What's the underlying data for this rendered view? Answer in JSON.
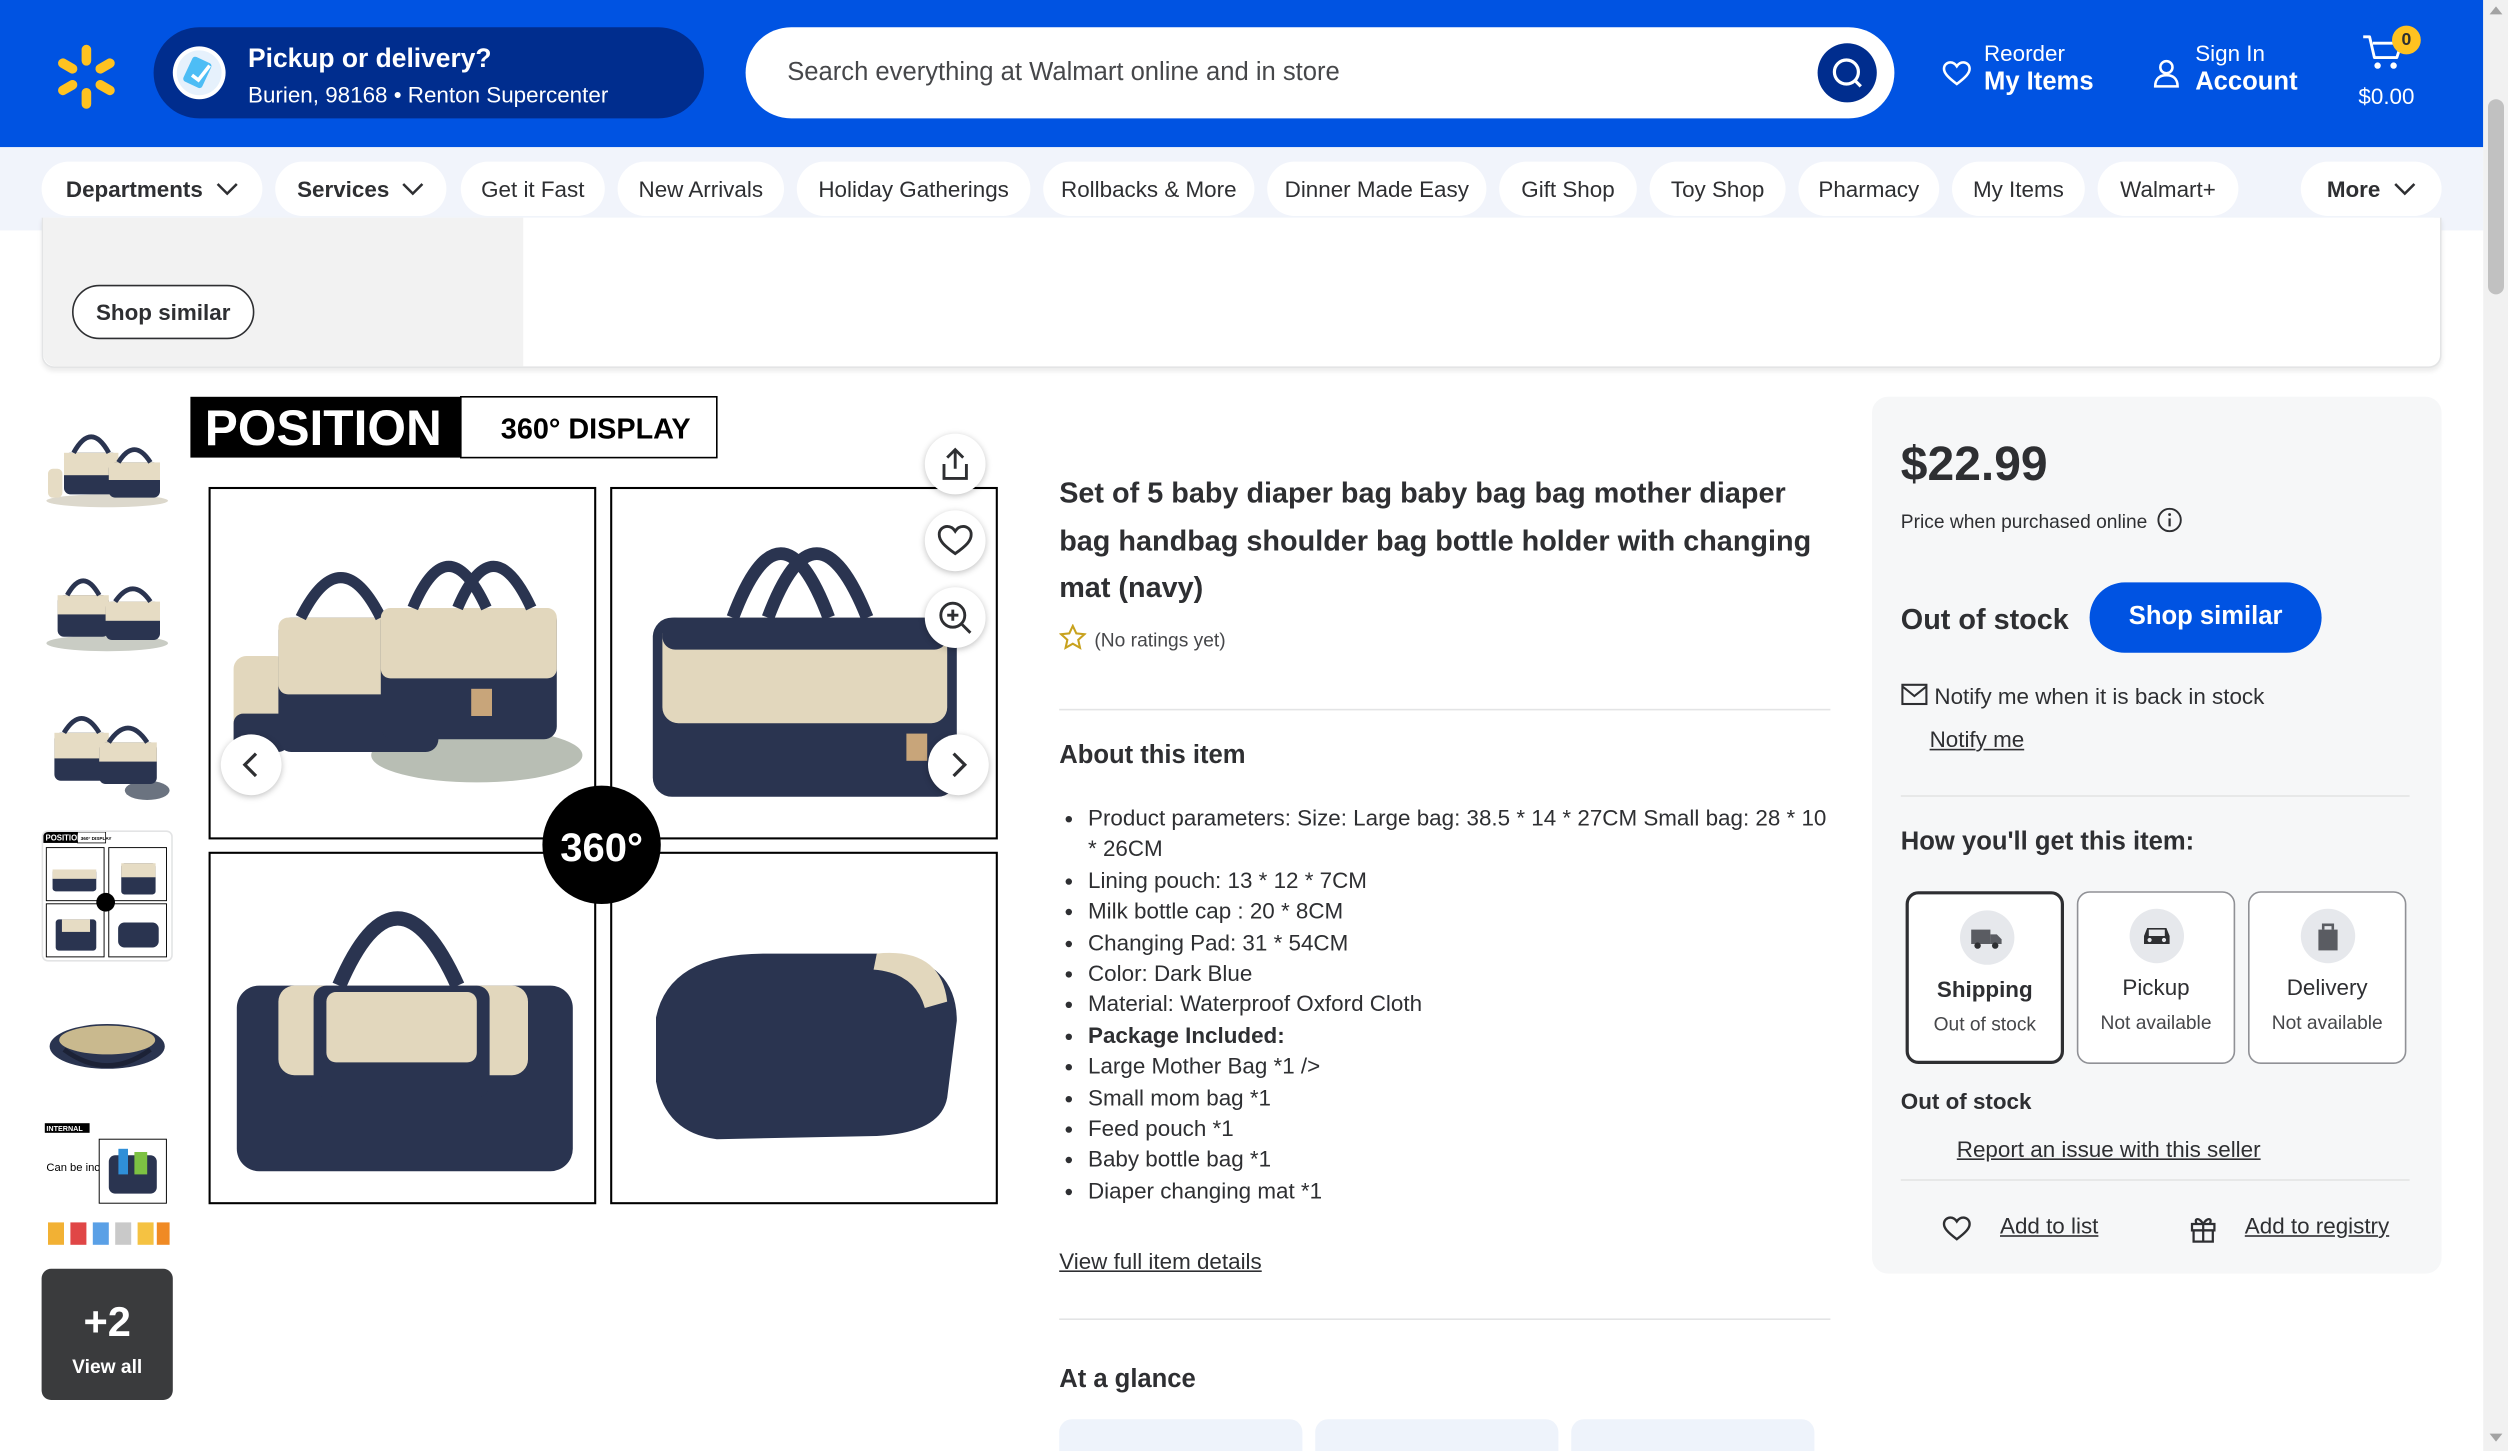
{
  "header": {
    "pickup_title": "Pickup or delivery?",
    "pickup_zip": "Burien, 98168",
    "pickup_store": "Renton Supercenter",
    "search_placeholder": "Search everything at Walmart online and in store",
    "reorder_small": "Reorder",
    "reorder_large": "My Items",
    "signin_small": "Sign In",
    "signin_large": "Account",
    "cart_count": "0",
    "cart_total": "$0.00",
    "brand_color": "#0053e2",
    "spark_color": "#ffc220"
  },
  "subnav": {
    "items": [
      "Departments",
      "Services",
      "Get it Fast",
      "New Arrivals",
      "Holiday Gatherings",
      "Rollbacks & More",
      "Dinner Made Easy",
      "Gift Shop",
      "Toy Shop",
      "Pharmacy",
      "My Items",
      "Walmart+",
      "More"
    ]
  },
  "promo": {
    "shop_similar": "Shop similar"
  },
  "gallery": {
    "banner_position": "POSITION",
    "banner_display": "360° DISPLAY",
    "badge_360": "360°",
    "thumb7_text1": "INTERNAL",
    "thumb7_text2": "Can be included",
    "view_all_count": "+2",
    "view_all_label": "View all"
  },
  "product": {
    "title": "Set of 5 baby diaper bag baby bag bag mother diaper bag handbag shoulder bag bottle holder with changing mat (navy)",
    "rating_text": "(No ratings yet)",
    "about_heading": "About this item",
    "bullets": [
      "Product parameters: Size: Large bag: 38.5 * 14 * 27CM Small bag: 28 * 10 * 26CM",
      "Lining pouch: 13 * 12 * 7CM",
      "Milk bottle cap : 20 * 8CM",
      "Changing Pad: 31 * 54CM",
      "Color: Dark Blue",
      "Material: Waterproof Oxford Cloth",
      "Package Included:",
      "Large Mother Bag *1 />",
      "Small mom bag *1",
      "Feed pouch *1",
      "Baby bottle bag *1",
      "Diaper changing mat *1"
    ],
    "view_full": "View full item details",
    "glance_heading": "At a glance"
  },
  "buybox": {
    "price": "$22.99",
    "price_note": "Price when purchased online",
    "stock_status": "Out of stock",
    "shop_similar": "Shop similar",
    "notify_text": "Notify me when it is back in stock",
    "notify_link": "Notify me",
    "how_heading": "How you'll get this item:",
    "options": [
      {
        "label": "Shipping",
        "status": "Out of stock"
      },
      {
        "label": "Pickup",
        "status": "Not available"
      },
      {
        "label": "Delivery",
        "status": "Not available"
      }
    ],
    "stock_status2": "Out of stock",
    "report_link": "Report an issue with this seller",
    "add_list": "Add to list",
    "add_registry": "Add to registry"
  }
}
